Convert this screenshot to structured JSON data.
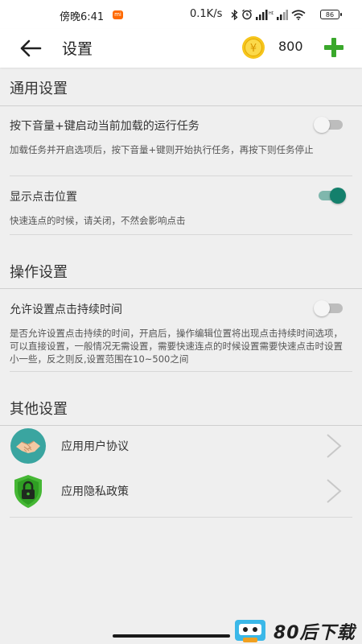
{
  "status_bar": {
    "time": "傍晚6:41",
    "mi_badge": "mi",
    "network_speed": "0.1K/s",
    "battery": "86"
  },
  "app_bar": {
    "title": "设置",
    "coin_symbol": "¥",
    "coins": "800"
  },
  "sections": {
    "general": {
      "header": "通用设置",
      "volume_key": {
        "title": "按下音量+键启动当前加载的运行任务",
        "desc": "加载任务并开启选项后，按下音量+键则开始执行任务，再按下则任务停止",
        "enabled": false
      },
      "show_click": {
        "title": "显示点击位置",
        "desc": "快速连点的时候，请关闭，不然会影响点击",
        "enabled": true
      }
    },
    "operation": {
      "header": "操作设置",
      "click_duration": {
        "title": "允许设置点击持续时间",
        "desc": "是否允许设置点击持续的时间，开启后，操作编辑位置将出现点击持续时间选项，可以直接设置，一般情况无需设置，需要快速连点的时候设置需要快速点击时设置小一些，反之则反,设置范围在10~500之间",
        "enabled": false
      }
    },
    "other": {
      "header": "其他设置",
      "items": [
        {
          "label": "应用用户协议",
          "icon": "handshake-icon"
        },
        {
          "label": "应用隐私政策",
          "icon": "privacy-shield-icon"
        }
      ]
    }
  },
  "watermark": {
    "text": "80后下载"
  },
  "colors": {
    "toggle_on": "#14806c",
    "add_green": "#3aa82b",
    "coin_gold": "#f6c51c"
  }
}
